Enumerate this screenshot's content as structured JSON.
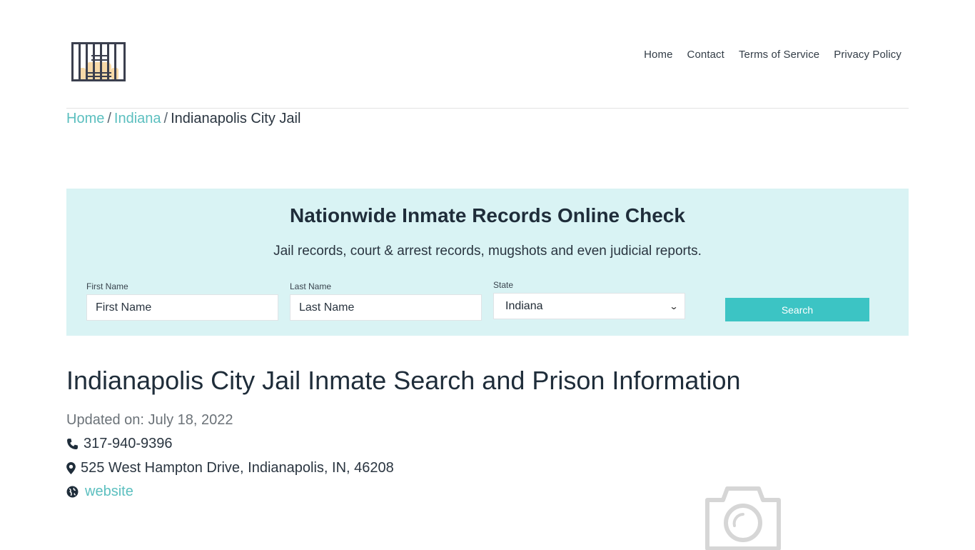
{
  "header": {
    "logo": "jail-bars-logo",
    "nav": [
      "Home",
      "Contact",
      "Terms of Service",
      "Privacy Policy"
    ]
  },
  "breadcrumb": {
    "items": [
      "Home",
      "Indiana"
    ],
    "current": "Indianapolis City Jail",
    "separator": "/"
  },
  "search": {
    "title": "Nationwide Inmate Records Online Check",
    "subtitle": "Jail records, court & arrest records, mugshots and even judicial reports.",
    "first_name_label": "First Name",
    "first_name_placeholder": "First Name",
    "last_name_label": "Last Name",
    "last_name_placeholder": "Last Name",
    "state_label": "State",
    "state_value": "Indiana",
    "button": "Search",
    "accent": "#3cc4c4",
    "background": "#d9f3f4"
  },
  "main": {
    "title": "Indianapolis City Jail Inmate Search and Prison Information",
    "updated": "Updated on: July 18, 2022",
    "phone": "317-940-9396",
    "address": "525 West Hampton Drive, Indianapolis, IN, 46208",
    "website": "website"
  }
}
